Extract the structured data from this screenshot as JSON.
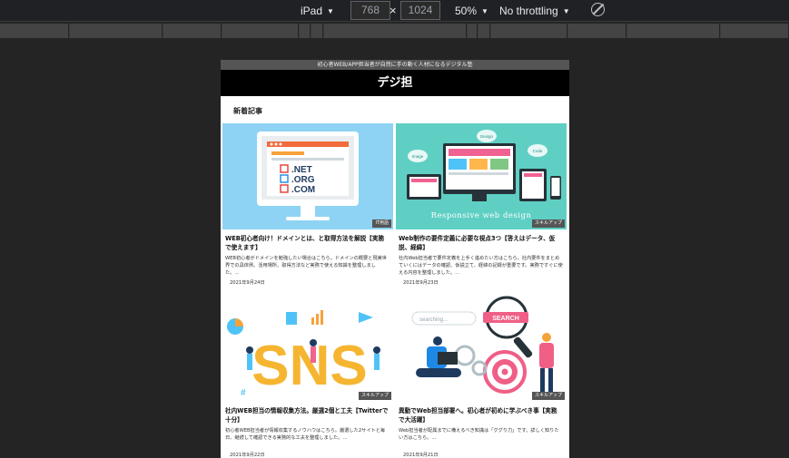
{
  "devtools": {
    "device": "iPad",
    "width": "768",
    "times": "×",
    "height": "1024",
    "zoom": "50%",
    "throttling": "No throttling"
  },
  "site": {
    "tagline": "初心者WEB/APP担当者が自然に手の動く人材になるデジタル塾",
    "name": "デジ担",
    "section_title": "新着記事"
  },
  "articles": [
    {
      "title": "WEB初心者向け！ドメインとは、と取得方法を解説【実務で使えます】",
      "excerpt": "WEB初心者がドメインを勉強したい場合はこちら。ドメインの概要と現実世界での具体例、活用場所、取得方法など実務で使える知識を整理しました。...",
      "date": "2021年9月24日",
      "badge": "IT用語"
    },
    {
      "title": "Web制作の要件定義に必要な視点3つ【答えはデータ、仮説、経緯】",
      "excerpt": "社内Web担当者で要件定義を上手く進めたい方はこちら。社内要件をまとめていくにはデータの確認、仮説立て、経緯の記録が重要です。実務ですぐに使える内容を整理しました。...",
      "date": "2021年9月23日",
      "badge": "スキルアップ"
    },
    {
      "title": "社内WEB担当の情報収集方法。厳選2個と工夫【Twitterで十分】",
      "excerpt": "初心者WEB担当者が情報収集するノウハウはこちら。厳選した2サイトと毎日、継続して確認できる実務的な工夫を整理しました。...",
      "date": "2021年9月22日",
      "badge": "スキルアップ"
    },
    {
      "title": "異動でWeb担当部署へ。初心者が初めに学ぶべき事【実務で大活躍】",
      "excerpt": "Web担当者が配属までに備えるべき知識は「ググり力」です。詳しく知りたい方はこちら。...",
      "date": "2021年9月21日",
      "badge": "スキルアップ"
    }
  ],
  "thumbs": {
    "domains": [
      ".NET",
      ".ORG",
      ".COM"
    ],
    "responsive": "Responsive web design",
    "bubbles": [
      "Image",
      "Design",
      "Code"
    ],
    "sns": "SNS",
    "search": "SEARCH",
    "searching": "searching..."
  }
}
